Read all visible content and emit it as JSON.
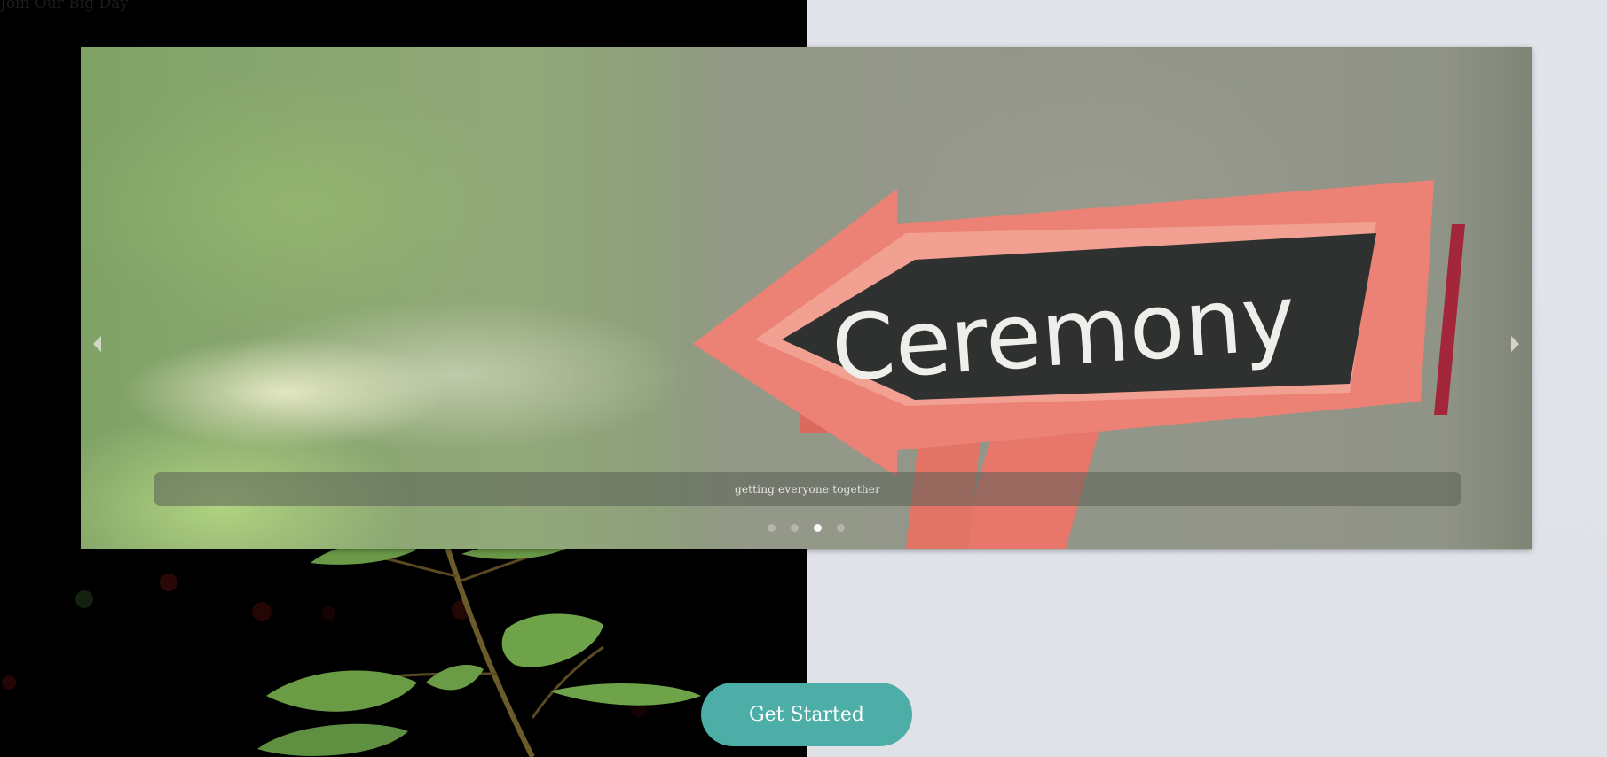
{
  "page": {
    "title": "Join Our Big Day"
  },
  "carousel": {
    "caption": "getting everyone together",
    "sign_text": "Ceremony",
    "slide_count": 4,
    "active_index": 2,
    "prev_icon": "chevron-left-icon",
    "next_icon": "chevron-right-icon"
  },
  "cta": {
    "label": "Get Started",
    "color": "#4caea6"
  },
  "colors": {
    "left_bg": "#000000",
    "right_bg": "#e0e3e8",
    "sign_frame": "#ea7f72",
    "chalkboard": "#2f3030"
  }
}
